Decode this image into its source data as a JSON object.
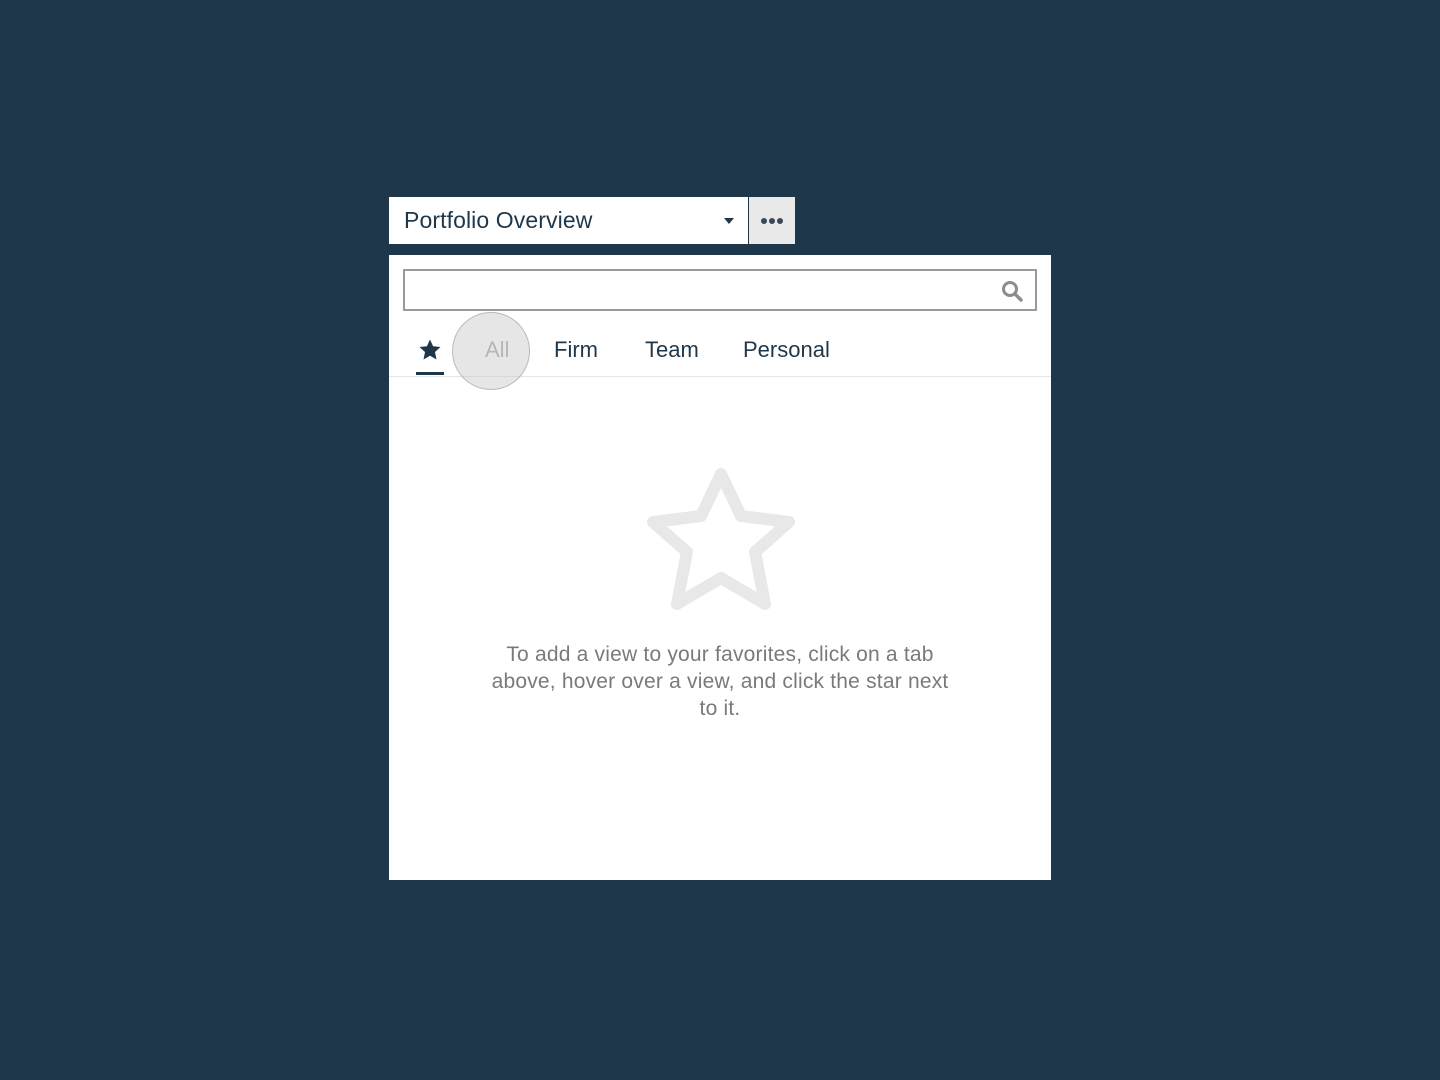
{
  "view_selector": {
    "title": "Portfolio Overview",
    "caret_icon": "caret-down-icon"
  },
  "more_button": {
    "icon": "more-horizontal-icon"
  },
  "search": {
    "value": "",
    "placeholder": "",
    "icon": "search-icon"
  },
  "tabs": [
    {
      "icon": "star-icon",
      "active": true
    },
    {
      "label": "All"
    },
    {
      "label": "Firm"
    },
    {
      "label": "Team"
    },
    {
      "label": "Personal"
    }
  ],
  "empty_state": {
    "icon": "star-outline-icon",
    "message": "To add a view to your favorites, click on a tab above, hover over a view, and click the star next to it."
  },
  "colors": {
    "background": "#1f374b",
    "accent": "#1f374b",
    "muted_text": "#7a7a7a",
    "empty_icon": "#e8e8e8"
  }
}
